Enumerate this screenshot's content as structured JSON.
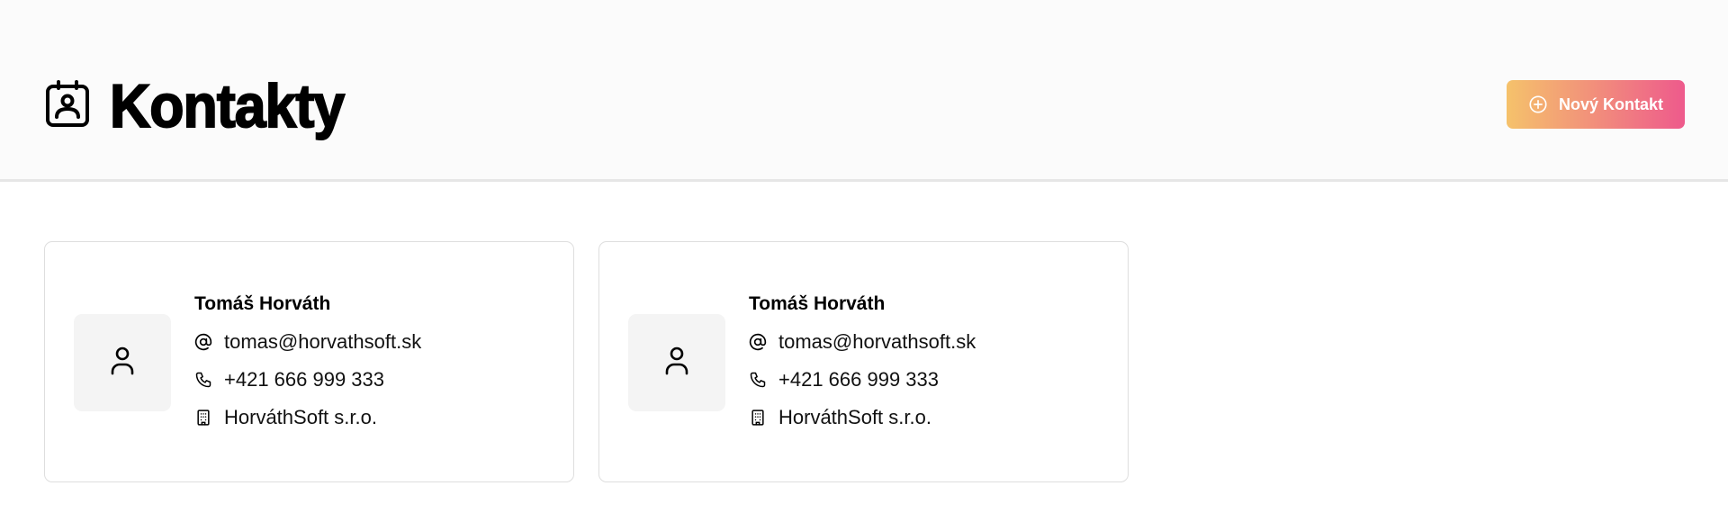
{
  "header": {
    "title": "Kontakty",
    "title_icon": "contact-card-icon",
    "new_contact_button": {
      "label": "Nový Kontakt",
      "icon": "plus-circle-icon"
    }
  },
  "colors": {
    "button_gradient_start": "#f5c26b",
    "button_gradient_end": "#ee5a8c",
    "header_background": "#fbfbfb",
    "avatar_background": "#f4f4f4"
  },
  "contacts": [
    {
      "name": "Tomáš Horváth",
      "email": "tomas@horvathsoft.sk",
      "phone": "+421 666 999 333",
      "company": "HorváthSoft s.r.o.",
      "avatar_icon": "user-icon",
      "email_icon": "at-sign-icon",
      "phone_icon": "phone-icon",
      "company_icon": "building-icon"
    },
    {
      "name": "Tomáš Horváth",
      "email": "tomas@horvathsoft.sk",
      "phone": "+421 666 999 333",
      "company": "HorváthSoft s.r.o.",
      "avatar_icon": "user-icon",
      "email_icon": "at-sign-icon",
      "phone_icon": "phone-icon",
      "company_icon": "building-icon"
    }
  ]
}
